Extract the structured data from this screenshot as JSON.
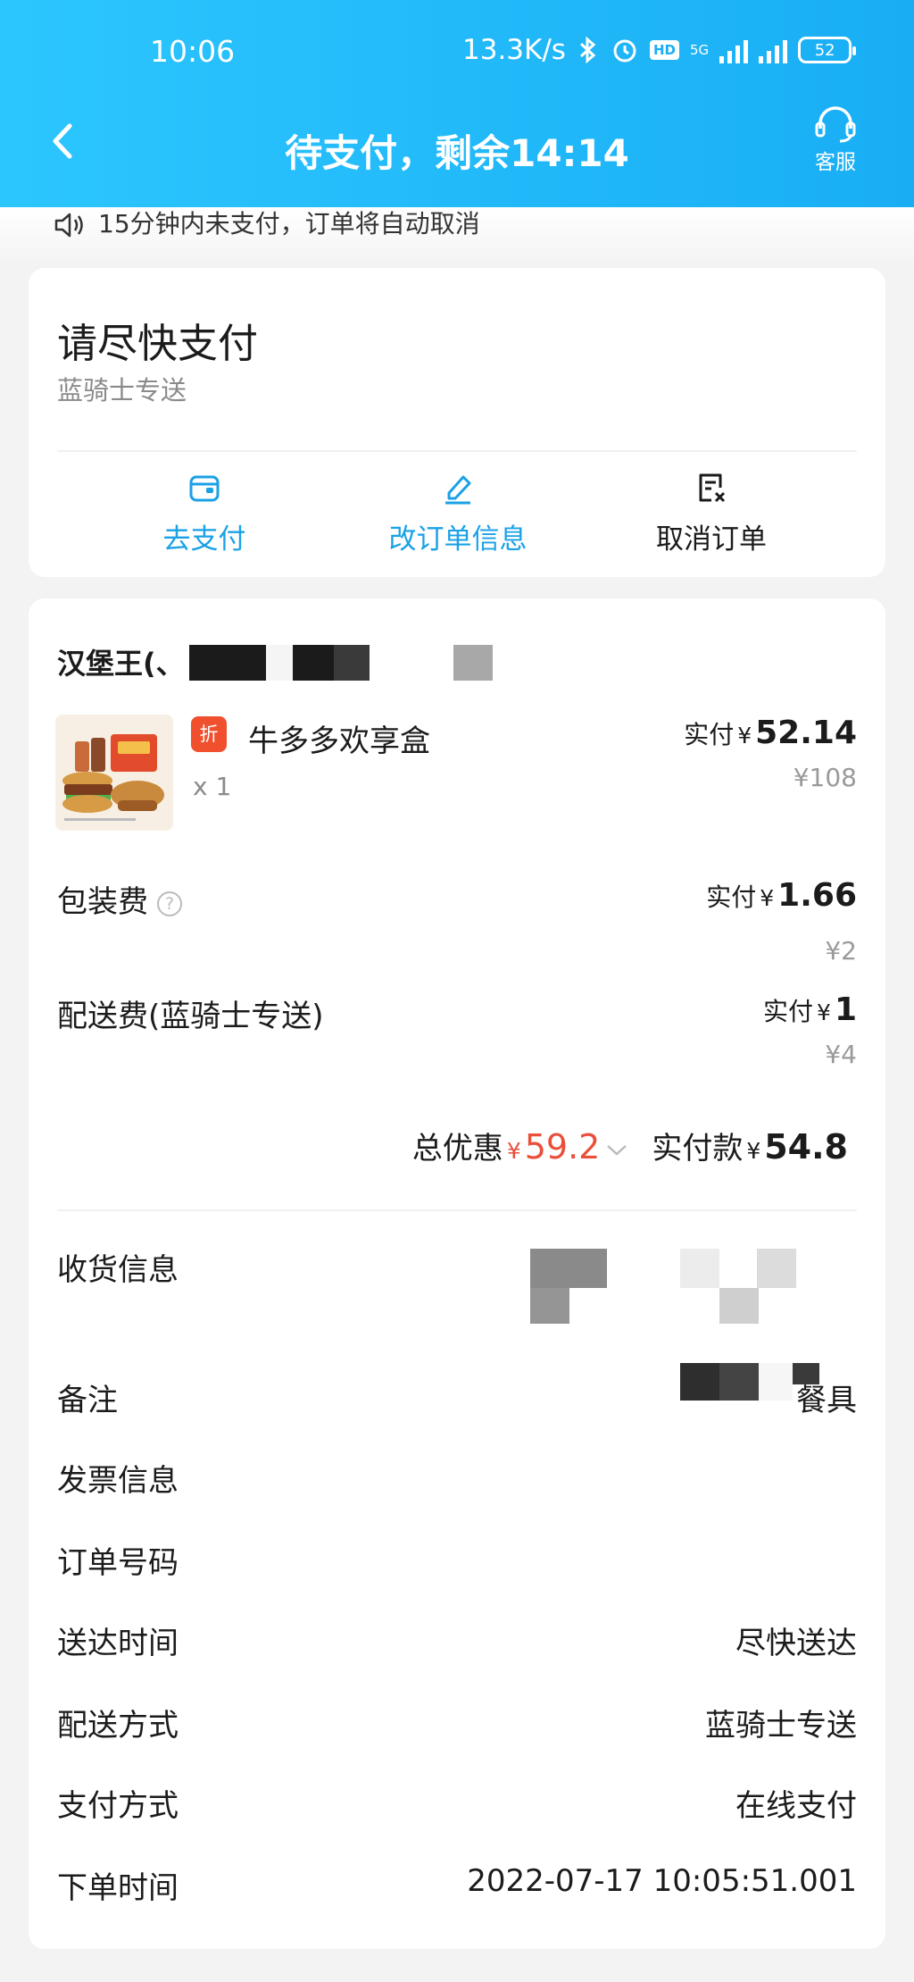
{
  "status_bar": {
    "time": "10:06",
    "net_speed": "13.3K/s",
    "hd_label": "HD",
    "network": "5G",
    "battery": "52"
  },
  "header": {
    "title": "待支付，剩余14:14",
    "service_label": "客服"
  },
  "notice": {
    "text": "15分钟内未支付，订单将自动取消"
  },
  "payment_card": {
    "title": "请尽快支付",
    "subtitle": "蓝骑士专送",
    "actions": [
      {
        "label": "去支付",
        "icon": "wallet-icon"
      },
      {
        "label": "改订单信息",
        "icon": "edit-icon"
      },
      {
        "label": "取消订单",
        "icon": "cancel-order-icon"
      }
    ]
  },
  "order": {
    "shop_name": "汉堡王(、",
    "item": {
      "discount_tag": "折",
      "name": "牛多多欢享盒",
      "qty": "x 1",
      "paid_label": "实付",
      "currency": "¥",
      "paid_price": "52.14",
      "original_price": "¥108"
    },
    "fees": [
      {
        "label": "包装费",
        "paid_label": "实付",
        "currency": "¥",
        "paid": "1.66",
        "original": "¥2"
      },
      {
        "label": "配送费(蓝骑士专送)",
        "paid_label": "实付",
        "currency": "¥",
        "paid": "1",
        "original": "¥4"
      }
    ],
    "summary": {
      "discount_label": "总优惠",
      "currency": "¥",
      "discount": "59.2",
      "total_label": "实付款",
      "total": "54.8"
    },
    "info_rows": [
      {
        "label": "收货信息",
        "value": ""
      },
      {
        "label": "备注",
        "value": "餐具"
      },
      {
        "label": "发票信息",
        "value": ""
      },
      {
        "label": "订单号码",
        "value": ""
      },
      {
        "label": "送达时间",
        "value": "尽快送达"
      },
      {
        "label": "配送方式",
        "value": "蓝骑士专送"
      },
      {
        "label": "支付方式",
        "value": "在线支付"
      },
      {
        "label": "下单时间",
        "value": "2022-07-17 10:05:51.001"
      }
    ]
  },
  "colors": {
    "header": "#19aef4",
    "accent_blue": "#1aa1e6",
    "discount_red": "#ea4f3a",
    "tag_red": "#f0502e"
  }
}
